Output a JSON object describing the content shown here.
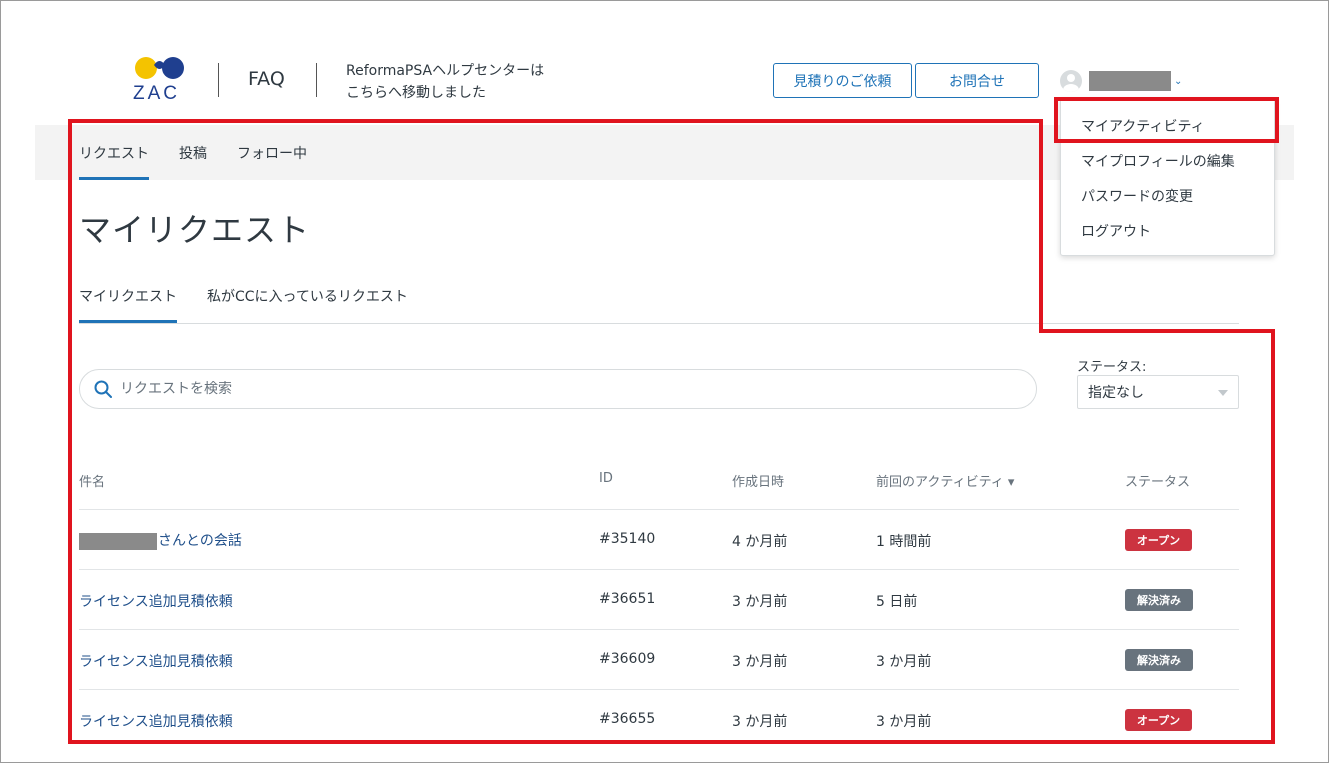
{
  "header": {
    "logo_text": "ZAC",
    "faq": "FAQ",
    "notice_line1": "ReformaPSAヘルプセンターは",
    "notice_line2": "こちらへ移動しました",
    "quote_button": "見積りのご依頼",
    "contact_button": "お問合せ",
    "user_chevron": "⌄"
  },
  "user_menu": {
    "items": [
      "マイアクティビティ",
      "マイプロフィールの編集",
      "パスワードの変更",
      "ログアウト"
    ]
  },
  "subnav": {
    "items": [
      "リクエスト",
      "投稿",
      "フォロー中"
    ]
  },
  "page": {
    "title": "マイリクエスト",
    "tabs": [
      "マイリクエスト",
      "私がCCに入っているリクエスト"
    ],
    "search_placeholder": "リクエストを検索",
    "status_label": "ステータス:",
    "status_value": "指定なし"
  },
  "table": {
    "headers": {
      "subject": "件名",
      "id": "ID",
      "created": "作成日時",
      "last_activity": "前回のアクティビティ ▾",
      "status": "ステータス"
    },
    "rows": [
      {
        "subject": "さんとの会話",
        "id": "#35140",
        "created": "4 か月前",
        "activity": "1 時間前",
        "status": "オープン"
      },
      {
        "subject": "ライセンス追加見積依頼",
        "id": "#36651",
        "created": "3 か月前",
        "activity": "5 日前",
        "status": "解決済み"
      },
      {
        "subject": "ライセンス追加見積依頼",
        "id": "#36609",
        "created": "3 か月前",
        "activity": "3 か月前",
        "status": "解決済み"
      },
      {
        "subject": "ライセンス追加見積依頼",
        "id": "#36655",
        "created": "3 か月前",
        "activity": "3 か月前",
        "status": "オープン"
      }
    ]
  },
  "colors": {
    "accent": "#1f73b7",
    "open_badge": "#cc3340",
    "solved_badge": "#68737d",
    "annotation_red": "#e0141e"
  }
}
